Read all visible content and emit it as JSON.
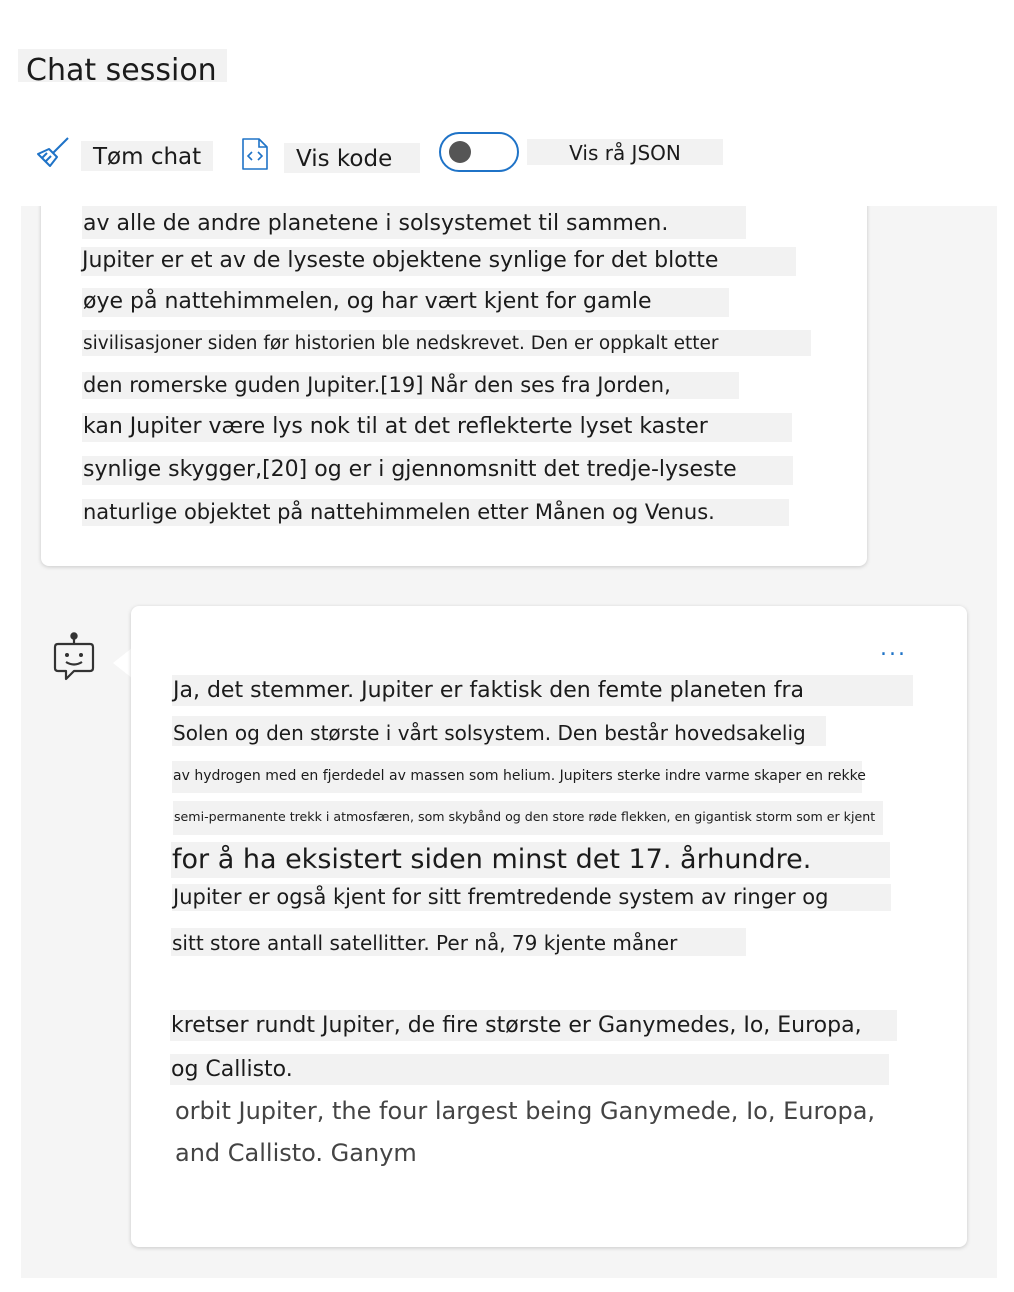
{
  "header": {
    "title": "Chat session"
  },
  "toolbar": {
    "clear_label": "Tøm chat",
    "code_label": "Vis kode",
    "json_label": "Vis rå JSON",
    "json_toggle_on": false,
    "accent_color": "#1f73c7"
  },
  "user_message": {
    "lines": [
      "av alle de andre planetene i solsystemet til sammen.",
      "Jupiter er et av de lyseste objektene synlige for det blotte",
      "øye på nattehimmelen, og har vært kjent for gamle",
      "sivilisasjoner siden før historien ble nedskrevet. Den er oppkalt etter",
      "den romerske guden Jupiter.[19] Når den ses fra Jorden,",
      "kan Jupiter være lys nok til at det reflekterte lyset kaster",
      "synlige skygger,[20] og er i gjennomsnitt det tredje-lyseste",
      "naturlige objektet på nattehimmelen etter Månen og Venus."
    ]
  },
  "bot_message": {
    "avatar_icon": "bot-icon",
    "more_label": "...",
    "lines": [
      "Ja, det stemmer. Jupiter er faktisk den femte planeten fra",
      "Solen og den største i vårt solsystem. Den består hovedsakelig",
      "av hydrogen med en fjerdedel av massen som helium. Jupiters sterke indre varme skaper en rekke",
      "semi-permanente trekk i atmosfæren, som skybånd og den store røde flekken, en gigantisk storm som er kjent",
      "for å ha eksistert siden minst det 17. århundre.",
      "Jupiter er også kjent for sitt fremtredende system av ringer og",
      "sitt store antall satellitter. Per nå, 79 kjente måner",
      "kretser rundt Jupiter, de fire største er Ganymedes, Io, Europa,",
      "og Callisto."
    ],
    "untranslated_lines": [
      "orbit Jupiter, the four largest being Ganymede, Io, Europa,",
      "and Callisto. Ganym"
    ]
  }
}
